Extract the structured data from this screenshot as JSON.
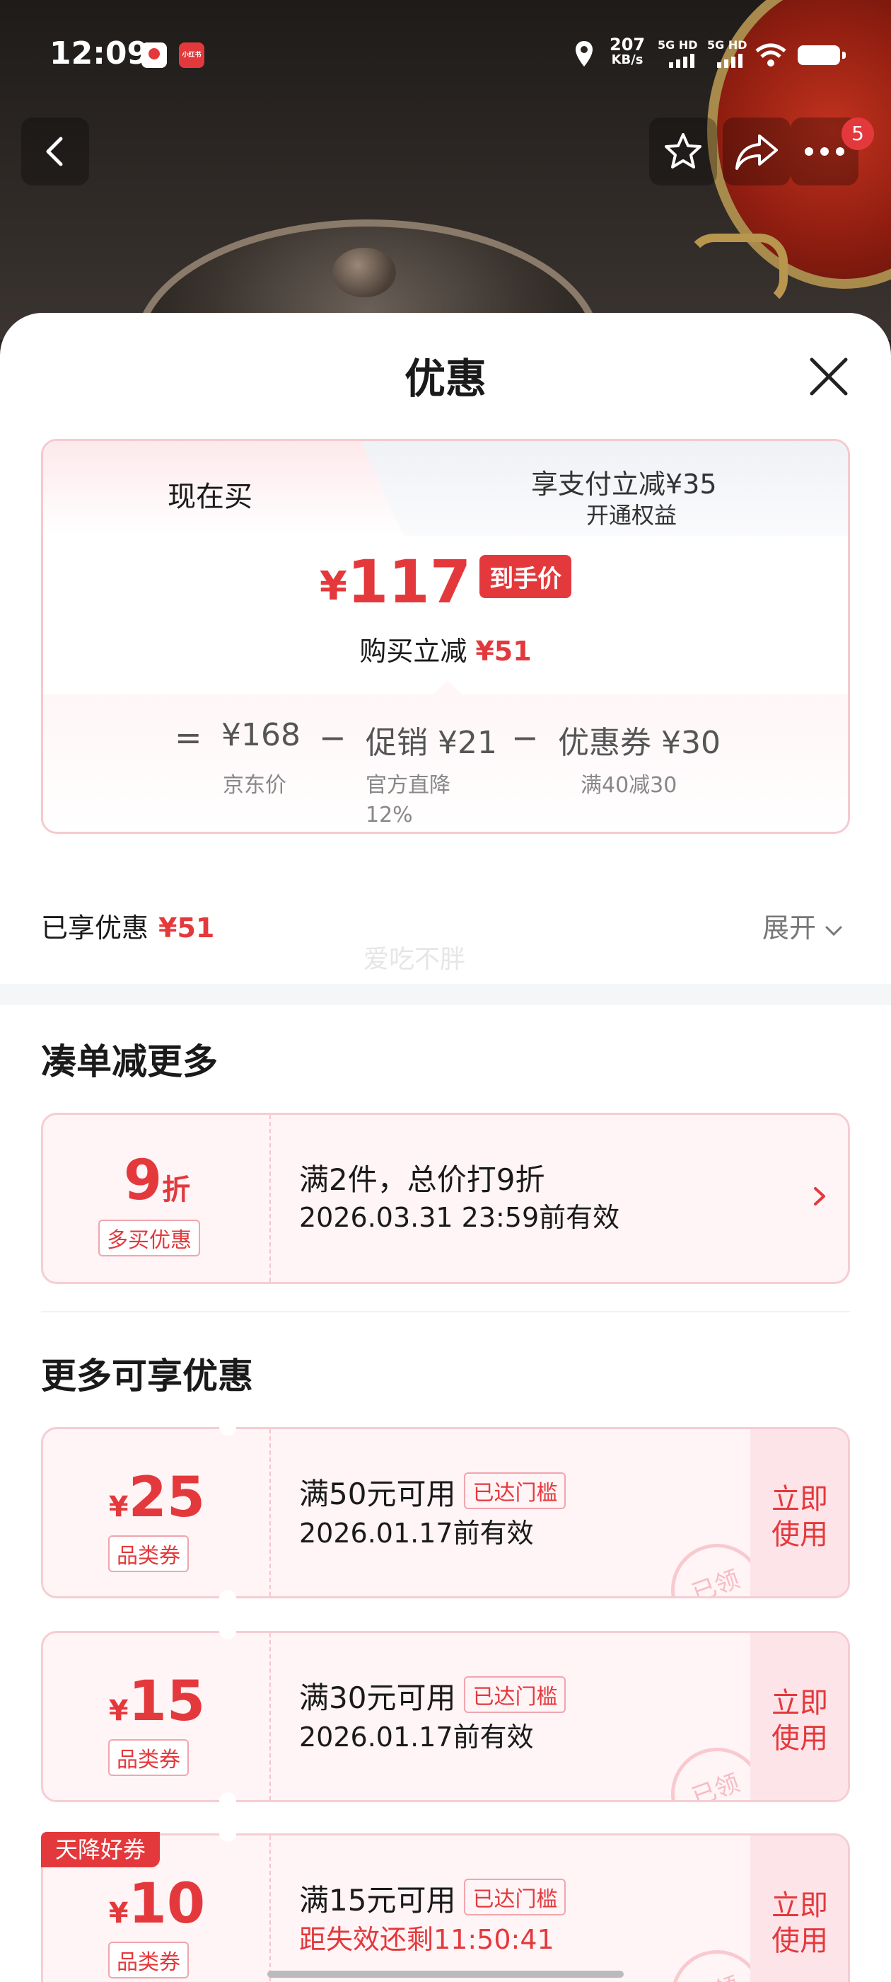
{
  "status_bar": {
    "time": "12:09",
    "app2_label": "小红书",
    "net_speed": "207",
    "net_unit": "KB/s",
    "sig1": "5G HD",
    "sig2": "5G HD"
  },
  "nav": {
    "badge_count": "5"
  },
  "sheet": {
    "title": "优惠"
  },
  "price_card": {
    "tab_now": "现在买",
    "tab_pay_label": "享支付立减¥35",
    "tab_pay_sub": "开通权益",
    "currency": "¥",
    "final_price": "117",
    "final_tag": "到手价",
    "saving_label": "购买立减",
    "saving_value": "¥51",
    "breakdown": {
      "eq": "=",
      "minus1": "−",
      "minus2": "−",
      "jd_price": "¥168",
      "jd_label": "京东价",
      "promo_value": "促销 ¥21",
      "promo_label": "官方直降",
      "promo_pct": "12%",
      "coupon_value": "优惠券 ¥30",
      "coupon_label": "满40减30"
    }
  },
  "enjoyed": {
    "label": "已享优惠",
    "value": "¥51",
    "expand": "展开"
  },
  "watermark": "爱吃不胖",
  "bundle_section": {
    "title": "凑单减更多",
    "deal": {
      "value": "9",
      "unit": "折",
      "type": "多买优惠",
      "line1": "满2件，总价打9折",
      "line2": "2026.03.31 23:59前有效"
    }
  },
  "more_section": {
    "title": "更多可享优惠",
    "coupons": [
      {
        "symbol": "¥",
        "value": "25",
        "type": "品类券",
        "line1": "满50元可用",
        "threshold": "已达门槛",
        "line2": "2026.01.17前有效",
        "use": "立即使用",
        "stamp": "已领"
      },
      {
        "symbol": "¥",
        "value": "15",
        "type": "品类券",
        "line1": "满30元可用",
        "threshold": "已达门槛",
        "line2": "2026.01.17前有效",
        "use": "立即使用",
        "stamp": "已领"
      },
      {
        "ribbon": "天降好券",
        "symbol": "¥",
        "value": "10",
        "type": "品类券",
        "line1": "满15元可用",
        "threshold": "已达门槛",
        "line2": "距失效还剩11:50:41",
        "use": "立即使用",
        "stamp": "已领"
      }
    ]
  },
  "colors": {
    "accent_red": "#e4393c",
    "coupon_bg": "#fff4f6",
    "coupon_border": "#f6cdd3"
  }
}
